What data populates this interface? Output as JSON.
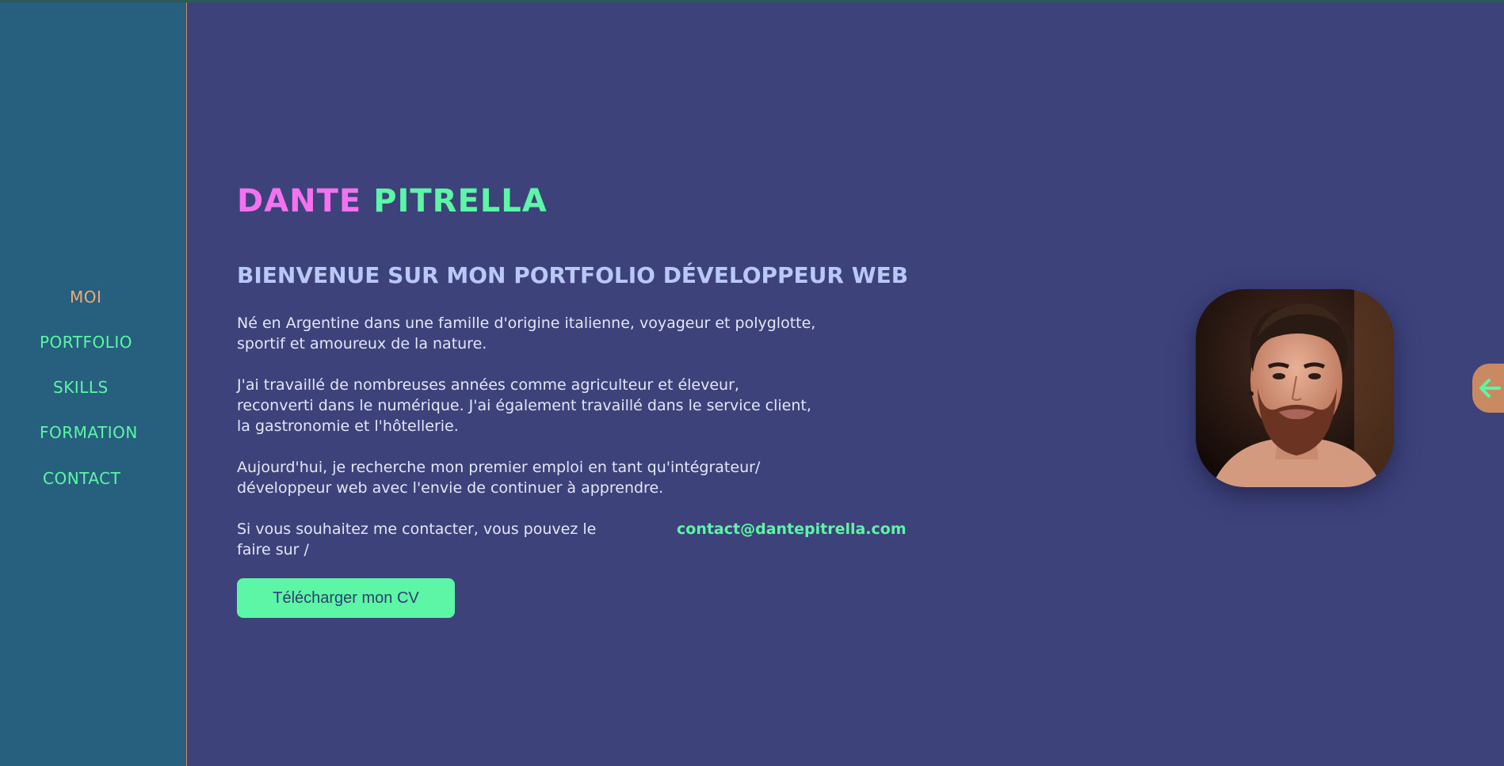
{
  "colors": {
    "background": "#3d427b",
    "sidebar": "#27607f",
    "accent_green": "#5cf6a6",
    "accent_pink": "#f472f0",
    "accent_orange": "#f3a974",
    "heading": "#b9c8f7"
  },
  "nav": {
    "items": [
      {
        "label": "MOI",
        "active": true
      },
      {
        "label": "PORTFOLIO"
      },
      {
        "label": "SKILLS"
      },
      {
        "label": "FORMATION"
      },
      {
        "label": "CONTACT"
      }
    ]
  },
  "hero": {
    "first_name": "DANTE",
    "last_name": "PITRELLA",
    "heading": "BIENVENUE SUR MON PORTFOLIO DÉVELOPPEUR WEB",
    "paragraphs": [
      [
        "Né en Argentine dans une famille d'origine italienne, voyageur et polyglotte,",
        "sportif et amoureux de la nature."
      ],
      [
        "J'ai travaillé de nombreuses années comme agriculteur et éleveur,",
        "reconverti dans le numérique. J'ai également travaillé dans le service client,",
        "la gastronomie et l'hôtellerie."
      ],
      [
        "Aujourd'hui, je recherche mon premier emploi en tant qu'intégrateur/",
        "développeur web avec l'envie de continuer à apprendre."
      ],
      [
        "Si vous souhaitez me contacter, vous pouvez le",
        "faire sur /"
      ]
    ],
    "contact_email": "contact@dantepitrella.com",
    "cv_button": "Télécharger mon CV"
  },
  "icons": {
    "back_tab": "arrow-left-icon",
    "photo": "profile-photo"
  }
}
